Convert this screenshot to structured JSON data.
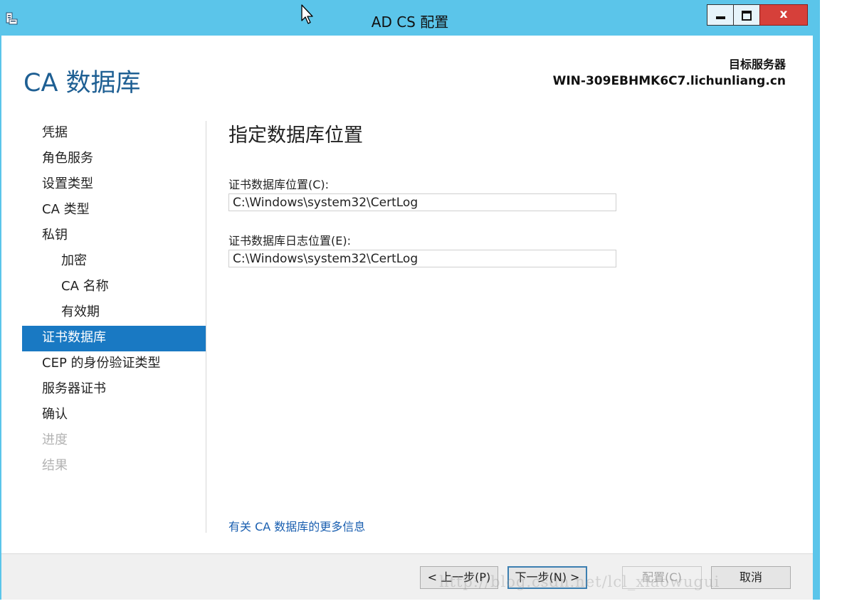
{
  "window": {
    "title": "AD CS 配置",
    "close_symbol": "x",
    "icons": [
      "server-manager-icon",
      "cursor-icon",
      "minimize-icon",
      "maximize-icon",
      "close-icon"
    ],
    "colors": {
      "titlebar": "#5bc5ea",
      "accent": "#1979c3",
      "header_text": "#1e5f93",
      "link": "#1a5fb0",
      "close_button": "#d6403a"
    }
  },
  "header": {
    "page_title": "CA 数据库",
    "target_label": "目标服务器",
    "target_server": "WIN-309EBHMK6C7.lichunliang.cn"
  },
  "nav": {
    "items": [
      {
        "label": "凭据",
        "state": "normal",
        "level": 0
      },
      {
        "label": "角色服务",
        "state": "normal",
        "level": 0
      },
      {
        "label": "设置类型",
        "state": "normal",
        "level": 0
      },
      {
        "label": "CA 类型",
        "state": "normal",
        "level": 0
      },
      {
        "label": "私钥",
        "state": "normal",
        "level": 0
      },
      {
        "label": "加密",
        "state": "normal",
        "level": 1
      },
      {
        "label": "CA 名称",
        "state": "normal",
        "level": 1
      },
      {
        "label": "有效期",
        "state": "normal",
        "level": 1
      },
      {
        "label": "证书数据库",
        "state": "active",
        "level": 0
      },
      {
        "label": "CEP 的身份验证类型",
        "state": "normal",
        "level": 0
      },
      {
        "label": "服务器证书",
        "state": "normal",
        "level": 0
      },
      {
        "label": "确认",
        "state": "normal",
        "level": 0
      },
      {
        "label": "进度",
        "state": "disabled",
        "level": 0
      },
      {
        "label": "结果",
        "state": "disabled",
        "level": 0
      }
    ]
  },
  "content": {
    "heading": "指定数据库位置",
    "db_location_label": "证书数据库位置(C):",
    "db_location_value": "C:\\Windows\\system32\\CertLog",
    "log_location_label": "证书数据库日志位置(E):",
    "log_location_value": "C:\\Windows\\system32\\CertLog",
    "more_info_link": "有关 CA 数据库的更多信息"
  },
  "footer": {
    "back_label": "< 上一步(P)",
    "next_label": "下一步(N) >",
    "configure_label": "配置(C)",
    "cancel_label": "取消",
    "watermark": "http://blog.csdn.net/lcl_xiaowugui"
  }
}
